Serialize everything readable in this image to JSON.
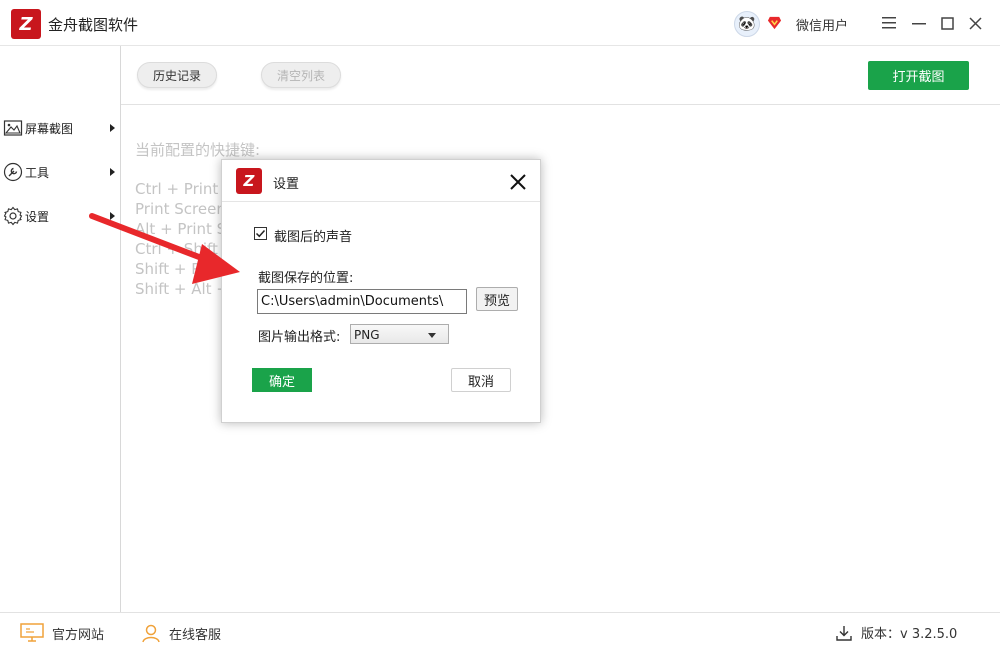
{
  "window": {
    "logo_glyph": "Z",
    "title": "金舟截图软件",
    "avatar_emoji": "🐼",
    "username": "微信用户",
    "vip_icon": "diamond-icon",
    "controls": [
      "menu-icon",
      "minimize-icon",
      "maximize-icon",
      "close-icon"
    ]
  },
  "toolbar": {
    "history_label": "历史记录",
    "clear_label": "清空列表",
    "open_label": "打开截图"
  },
  "sidebar": {
    "items": [
      {
        "label": "屏幕截图",
        "icon": "image-icon"
      },
      {
        "label": "工具",
        "icon": "wrench-icon"
      },
      {
        "label": "设置",
        "icon": "gear-icon"
      }
    ]
  },
  "main": {
    "hotkey_title": "当前配置的快捷键:",
    "hotkeys": [
      "Ctrl + Print S",
      "Print Screen",
      "Alt + Print Sc",
      "Ctrl + Shift +",
      "Shift + Prin",
      "Shift + Alt +"
    ]
  },
  "dialog": {
    "logo_glyph": "Z",
    "title": "设置",
    "sound_label": "截图后的声音",
    "sound_checked": true,
    "path_label": "截图保存的位置:",
    "path_value": "C:\\Users\\admin\\Documents\\",
    "browse_label": "预览",
    "format_label": "图片输出格式:",
    "format_value": "PNG",
    "ok_label": "确定",
    "cancel_label": "取消"
  },
  "footer": {
    "website_label": "官方网站",
    "service_label": "在线客服",
    "version_label": "版本：v 3.2.5.0"
  },
  "colors": {
    "brand_red": "#c8161d",
    "accent_green": "#1aa34a",
    "annotation_red": "#e8282b"
  }
}
